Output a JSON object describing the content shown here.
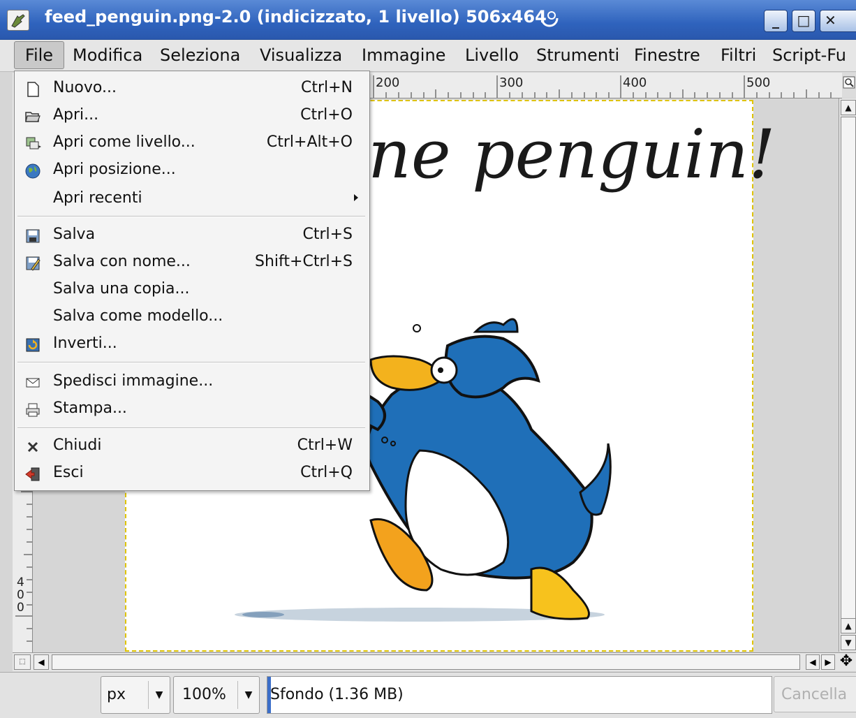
{
  "window": {
    "title": "feed_penguin.png-2.0 (indicizzato, 1 livello) 506x464",
    "buttons": {
      "minimize": "_",
      "maximize": "□",
      "close": "✕"
    }
  },
  "menubar": {
    "items": [
      {
        "label": "File"
      },
      {
        "label": "Modifica"
      },
      {
        "label": "Seleziona"
      },
      {
        "label": "Visualizza"
      },
      {
        "label": "Immagine"
      },
      {
        "label": "Livello"
      },
      {
        "label": "Strumenti"
      },
      {
        "label": "Finestre"
      },
      {
        "label": "Filtri"
      },
      {
        "label": "Script-Fu"
      }
    ]
  },
  "file_menu": {
    "items": [
      {
        "label": "Nuovo...",
        "accel": "Ctrl+N",
        "icon": "new-document-icon"
      },
      {
        "label": "Apri...",
        "accel": "Ctrl+O",
        "icon": "open-folder-icon"
      },
      {
        "label": "Apri come livello...",
        "accel": "Ctrl+Alt+O",
        "icon": "open-as-layer-icon"
      },
      {
        "label": "Apri posizione...",
        "accel": "",
        "icon": "globe-icon"
      },
      {
        "label": "Apri recenti",
        "accel": "",
        "icon": "",
        "submenu": true
      },
      {
        "label": "Salva",
        "accel": "Ctrl+S",
        "icon": "save-icon"
      },
      {
        "label": "Salva con nome...",
        "accel": "Shift+Ctrl+S",
        "icon": "save-as-icon"
      },
      {
        "label": "Salva una copia...",
        "accel": "",
        "icon": ""
      },
      {
        "label": "Salva come modello...",
        "accel": "",
        "icon": ""
      },
      {
        "label": "Inverti...",
        "accel": "",
        "icon": "revert-icon"
      },
      {
        "label": "Spedisci immagine...",
        "accel": "",
        "icon": "mail-icon"
      },
      {
        "label": "Stampa...",
        "accel": "",
        "icon": "print-icon"
      },
      {
        "label": "Chiudi",
        "accel": "Ctrl+W",
        "icon": "close-icon"
      },
      {
        "label": "Esci",
        "accel": "Ctrl+Q",
        "icon": "quit-icon"
      }
    ]
  },
  "rulers": {
    "top_ticks": [
      "200",
      "300",
      "400",
      "500"
    ],
    "left_ticks": [
      "4",
      "0",
      "0"
    ]
  },
  "canvas": {
    "headline": "ne penguin!"
  },
  "statusbar": {
    "unit": "px",
    "zoom": "100%",
    "layer_info": "Sfondo (1.36 MB)",
    "cancel": "Cancella"
  }
}
